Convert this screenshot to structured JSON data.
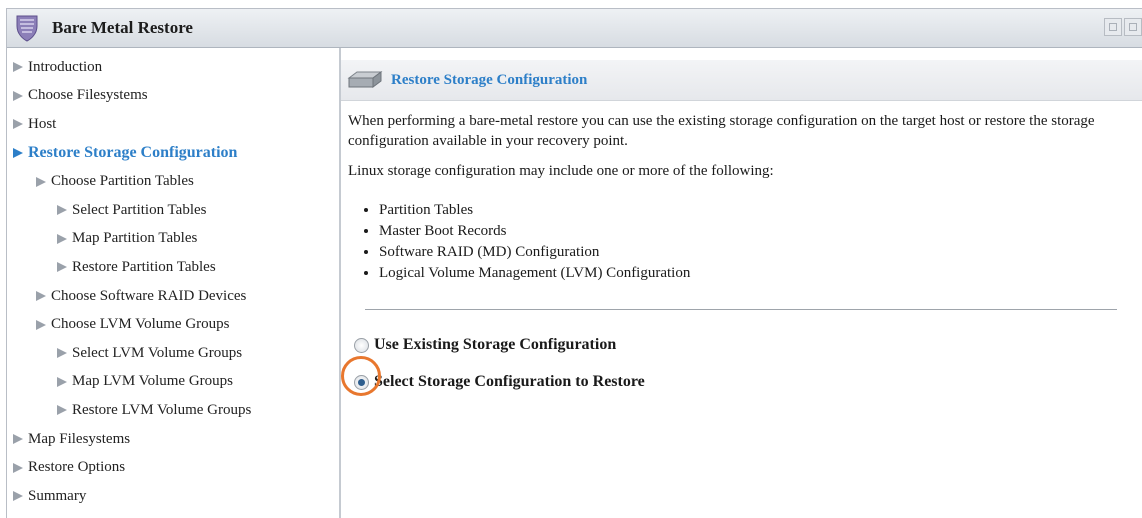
{
  "window": {
    "title": "Bare Metal Restore",
    "icon": "shield-icon"
  },
  "nav": {
    "items": [
      {
        "label": "Introduction",
        "level": 0,
        "active": false
      },
      {
        "label": "Choose Filesystems",
        "level": 0,
        "active": false
      },
      {
        "label": "Host",
        "level": 0,
        "active": false
      },
      {
        "label": "Restore Storage Configuration",
        "level": 0,
        "active": true
      },
      {
        "label": "Choose Partition Tables",
        "level": 1,
        "active": false
      },
      {
        "label": "Select Partition Tables",
        "level": 2,
        "active": false
      },
      {
        "label": "Map Partition Tables",
        "level": 2,
        "active": false
      },
      {
        "label": "Restore Partition Tables",
        "level": 2,
        "active": false
      },
      {
        "label": "Choose Software RAID Devices",
        "level": 1,
        "active": false
      },
      {
        "label": "Choose LVM Volume Groups",
        "level": 1,
        "active": false
      },
      {
        "label": "Select LVM Volume Groups",
        "level": 2,
        "active": false
      },
      {
        "label": "Map LVM Volume Groups",
        "level": 2,
        "active": false
      },
      {
        "label": "Restore LVM Volume Groups",
        "level": 2,
        "active": false
      },
      {
        "label": "Map Filesystems",
        "level": 0,
        "active": false
      },
      {
        "label": "Restore Options",
        "level": 0,
        "active": false
      },
      {
        "label": "Summary",
        "level": 0,
        "active": false
      }
    ]
  },
  "main": {
    "section_title": "Restore Storage Configuration",
    "section_icon": "disk-icon",
    "para1": "When performing a bare-metal restore you can use the existing storage configuration on the target host or restore the storage configuration available in your recovery point.",
    "para2": "Linux storage configuration may include one or more of the following:",
    "bullets": [
      "Partition Tables",
      "Master Boot Records",
      "Software RAID (MD) Configuration",
      "Logical Volume Management (LVM) Configuration"
    ],
    "options": [
      {
        "label": "Use Existing Storage Configuration",
        "checked": false
      },
      {
        "label": "Select Storage Configuration to Restore",
        "checked": true
      }
    ]
  },
  "colors": {
    "accent": "#2d7fc8",
    "highlight": "#e8772e"
  }
}
